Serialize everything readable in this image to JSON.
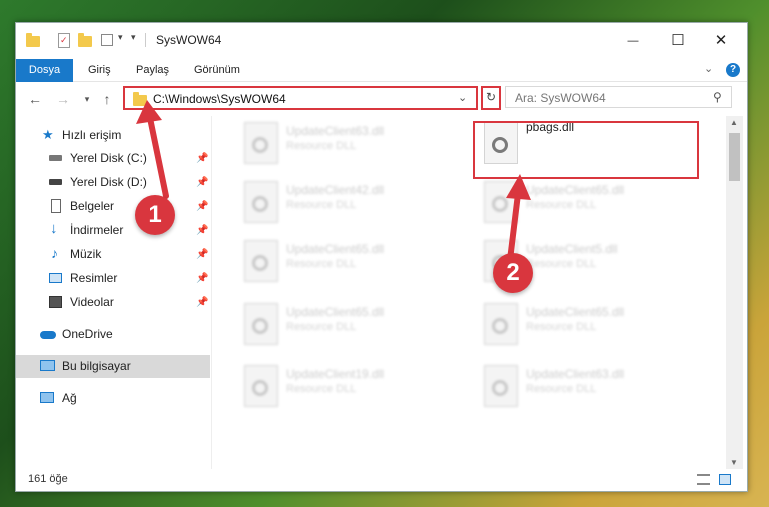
{
  "window": {
    "title": "SysWOW64",
    "controls": {
      "minimize": "—",
      "maximize": "☐",
      "close": "✕"
    }
  },
  "ribbon": {
    "tabs": [
      "Dosya",
      "Giriş",
      "Paylaş",
      "Görünüm"
    ]
  },
  "address": {
    "path": "C:\\Windows\\SysWOW64",
    "dropdown_icon": "chevron-down-icon",
    "refresh_icon": "refresh-icon"
  },
  "search": {
    "placeholder": "Ara: SysWOW64"
  },
  "sidebar": {
    "quick_access": "Hızlı erişim",
    "items": [
      {
        "label": "Yerel Disk (C:)",
        "icon": "drive-icon",
        "pinned": true
      },
      {
        "label": "Yerel Disk (D:)",
        "icon": "drive-icon",
        "pinned": true
      },
      {
        "label": "Belgeler",
        "icon": "documents-icon",
        "pinned": true
      },
      {
        "label": "İndirmeler",
        "icon": "downloads-icon",
        "pinned": true
      },
      {
        "label": "Müzik",
        "icon": "music-icon",
        "pinned": true
      },
      {
        "label": "Resimler",
        "icon": "pictures-icon",
        "pinned": true
      },
      {
        "label": "Videolar",
        "icon": "videos-icon",
        "pinned": true
      }
    ],
    "onedrive": "OneDrive",
    "this_pc": "Bu bilgisayar",
    "network": "Ağ"
  },
  "files": {
    "left_column": [
      {
        "name": "UpdateClient63.dll",
        "desc": "Resource DLL"
      },
      {
        "name": "UpdateClient42.dll",
        "desc": "Resource DLL"
      },
      {
        "name": "UpdateClient65.dll",
        "desc": "Resource DLL"
      },
      {
        "name": "UpdateClient65.dll",
        "desc": "Resource DLL"
      },
      {
        "name": "UpdateClient19.dll",
        "desc": "Resource DLL"
      }
    ],
    "right_column": [
      {
        "name": "pbags.dll",
        "desc": ""
      },
      {
        "name": "UpdateClient65.dll",
        "desc": "Resource DLL"
      },
      {
        "name": "UpdateClient5.dll",
        "desc": "Resource DLL"
      },
      {
        "name": "UpdateClient65.dll",
        "desc": "Resource DLL"
      },
      {
        "name": "UpdateClient63.dll",
        "desc": "Resource DLL"
      }
    ]
  },
  "status": {
    "count": "161 öğe"
  },
  "annotations": {
    "step1": "1",
    "step2": "2",
    "color": "#d9363e"
  }
}
